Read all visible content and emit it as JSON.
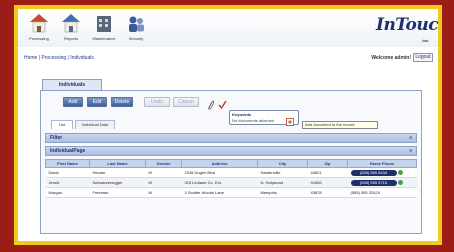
{
  "nav": {
    "items": [
      {
        "label": "Processing",
        "icon": "house-icon"
      },
      {
        "label": "Reports",
        "icon": "house-icon"
      },
      {
        "label": "Maintenance",
        "icon": "building-icon"
      },
      {
        "label": "Security",
        "icon": "people-icon"
      }
    ]
  },
  "logo": {
    "text": "InTouch",
    "sub": "data"
  },
  "breadcrumb": "Home | Processing | Individuals",
  "welcome": "Welcome admin!",
  "logout_label": "Logout",
  "panel_tab": "Individuals",
  "toolbar": {
    "add": "Add",
    "edit": "Edit",
    "delete": "Delete",
    "undo": "Undo",
    "cancel": "Cancel"
  },
  "keywords_box": {
    "title": "Keywords",
    "subtitle": "No documents attached"
  },
  "tooltip": "Add document to the record",
  "subtabs": [
    "List",
    "Individual Data"
  ],
  "groups": [
    {
      "label": "Filter",
      "chevron": "»"
    },
    {
      "label": "IndividualPage",
      "chevron": "»"
    }
  ],
  "table": {
    "columns": [
      "First Name",
      "Last Name",
      "Gender",
      "Address",
      "City",
      "Zip",
      "Home Phone"
    ],
    "rows": [
      {
        "first": "David",
        "last": "Hecam",
        "gender": "M",
        "address": "2345 Dugen Blvd",
        "city": "Hardenville",
        "zip": "44521",
        "phone": "(555) 555 5434"
      },
      {
        "first": "Jerold",
        "last": "Schwarzenegger",
        "gender": "M",
        "address": "315 Lindane Co. Ext.",
        "city": "N. Holywood",
        "zip": "91606",
        "phone": "(555) 555 5715"
      },
      {
        "first": "Morgan",
        "last": "Freeman",
        "gender": "M",
        "address": "3 Scatter Woods Lane",
        "city": "Memphis",
        "zip": "43878",
        "phone": "(555) 555 3242X"
      }
    ]
  },
  "colors": {
    "background": "#9c1c17",
    "frame": "#f1cb1c",
    "brand": "#1e2f6e",
    "header_row": "#c5d4ed"
  }
}
